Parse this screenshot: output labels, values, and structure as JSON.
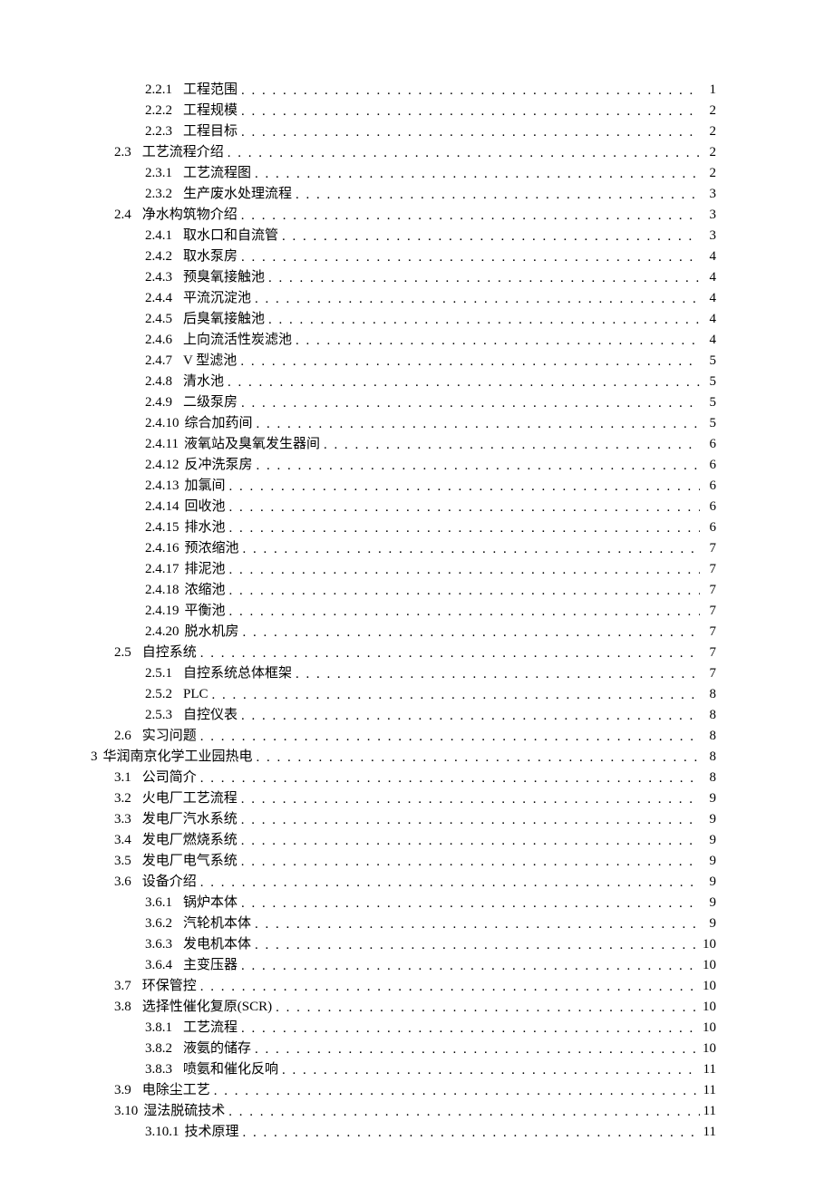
{
  "toc": [
    {
      "level": 2,
      "num": "2.2.1",
      "title": "工程范围",
      "page": "1"
    },
    {
      "level": 2,
      "num": "2.2.2",
      "title": "工程规模",
      "page": "2"
    },
    {
      "level": 2,
      "num": "2.2.3",
      "title": "工程目标",
      "page": "2"
    },
    {
      "level": 1,
      "num": "2.3",
      "title": "工艺流程介绍",
      "page": "2"
    },
    {
      "level": 2,
      "num": "2.3.1",
      "title": "工艺流程图",
      "page": "2"
    },
    {
      "level": 2,
      "num": "2.3.2",
      "title": "生产废水处理流程",
      "page": "3"
    },
    {
      "level": 1,
      "num": "2.4",
      "title": "净水构筑物介绍",
      "page": "3"
    },
    {
      "level": 2,
      "num": "2.4.1",
      "title": "取水口和自流管",
      "page": "3"
    },
    {
      "level": 2,
      "num": "2.4.2",
      "title": "取水泵房",
      "page": "4"
    },
    {
      "level": 2,
      "num": "2.4.3",
      "title": "预臭氧接触池",
      "page": "4"
    },
    {
      "level": 2,
      "num": "2.4.4",
      "title": "平流沉淀池",
      "page": "4"
    },
    {
      "level": 2,
      "num": "2.4.5",
      "title": "后臭氧接触池",
      "page": "4"
    },
    {
      "level": 2,
      "num": "2.4.6",
      "title": "上向流活性炭滤池",
      "page": "4"
    },
    {
      "level": 2,
      "num": "2.4.7",
      "title": "V 型滤池",
      "page": "5"
    },
    {
      "level": 2,
      "num": "2.4.8",
      "title": "清水池",
      "page": "5"
    },
    {
      "level": 2,
      "num": "2.4.9",
      "title": "二级泵房",
      "page": "5"
    },
    {
      "level": 2,
      "num": "2.4.10",
      "title": "综合加药间",
      "page": "5",
      "tight": true
    },
    {
      "level": 2,
      "num": "2.4.11",
      "title": "液氧站及臭氧发生器间",
      "page": "6",
      "tight": true
    },
    {
      "level": 2,
      "num": "2.4.12",
      "title": "反冲洗泵房",
      "page": "6",
      "tight": true
    },
    {
      "level": 2,
      "num": "2.4.13",
      "title": "加氯间",
      "page": "6",
      "tight": true
    },
    {
      "level": 2,
      "num": "2.4.14",
      "title": "回收池",
      "page": "6",
      "tight": true
    },
    {
      "level": 2,
      "num": "2.4.15",
      "title": "排水池",
      "page": "6",
      "tight": true
    },
    {
      "level": 2,
      "num": "2.4.16",
      "title": "预浓缩池",
      "page": "7",
      "tight": true
    },
    {
      "level": 2,
      "num": "2.4.17",
      "title": "排泥池",
      "page": "7",
      "tight": true
    },
    {
      "level": 2,
      "num": "2.4.18",
      "title": "浓缩池",
      "page": "7",
      "tight": true
    },
    {
      "level": 2,
      "num": "2.4.19",
      "title": "平衡池",
      "page": "7",
      "tight": true
    },
    {
      "level": 2,
      "num": "2.4.20",
      "title": "脱水机房",
      "page": "7",
      "tight": true
    },
    {
      "level": 1,
      "num": "2.5",
      "title": "自控系统",
      "page": "7"
    },
    {
      "level": 2,
      "num": "2.5.1",
      "title": "自控系统总体框架",
      "page": "7"
    },
    {
      "level": 2,
      "num": "2.5.2",
      "title": "PLC",
      "page": "8"
    },
    {
      "level": 2,
      "num": "2.5.3",
      "title": "自控仪表",
      "page": "8"
    },
    {
      "level": 1,
      "num": "2.6",
      "title": "实习问题",
      "page": "8"
    },
    {
      "level": 0,
      "num": "3",
      "title": "华润南京化学工业园热电",
      "page": "8",
      "tight": true
    },
    {
      "level": 1,
      "num": "3.1",
      "title": "公司简介",
      "page": "8"
    },
    {
      "level": 1,
      "num": "3.2",
      "title": "火电厂工艺流程",
      "page": "9"
    },
    {
      "level": 1,
      "num": "3.3",
      "title": "发电厂汽水系统",
      "page": "9"
    },
    {
      "level": 1,
      "num": "3.4",
      "title": "发电厂燃烧系统",
      "page": "9"
    },
    {
      "level": 1,
      "num": "3.5",
      "title": "发电厂电气系统",
      "page": "9"
    },
    {
      "level": 1,
      "num": "3.6",
      "title": "设备介绍",
      "page": "9"
    },
    {
      "level": 2,
      "num": "3.6.1",
      "title": "锅炉本体",
      "page": "9"
    },
    {
      "level": 2,
      "num": "3.6.2",
      "title": "汽轮机本体",
      "page": "9"
    },
    {
      "level": 2,
      "num": "3.6.3",
      "title": "发电机本体",
      "page": "10"
    },
    {
      "level": 2,
      "num": "3.6.4",
      "title": "主变压器",
      "page": "10"
    },
    {
      "level": 1,
      "num": "3.7",
      "title": "环保管控",
      "page": "10"
    },
    {
      "level": 1,
      "num": "3.8",
      "title": "选择性催化复原(SCR)",
      "page": "10"
    },
    {
      "level": 2,
      "num": "3.8.1",
      "title": "工艺流程",
      "page": "10"
    },
    {
      "level": 2,
      "num": "3.8.2",
      "title": "液氨的储存",
      "page": "10"
    },
    {
      "level": 2,
      "num": "3.8.3",
      "title": "喷氨和催化反响",
      "page": "11"
    },
    {
      "level": 1,
      "num": "3.9",
      "title": "电除尘工艺",
      "page": "11"
    },
    {
      "level": 1,
      "num": "3.10",
      "title": "湿法脱硫技术",
      "page": "11",
      "tight": true
    },
    {
      "level": 2,
      "num": "3.10.1",
      "title": "技术原理",
      "page": "11",
      "tight": true
    }
  ]
}
